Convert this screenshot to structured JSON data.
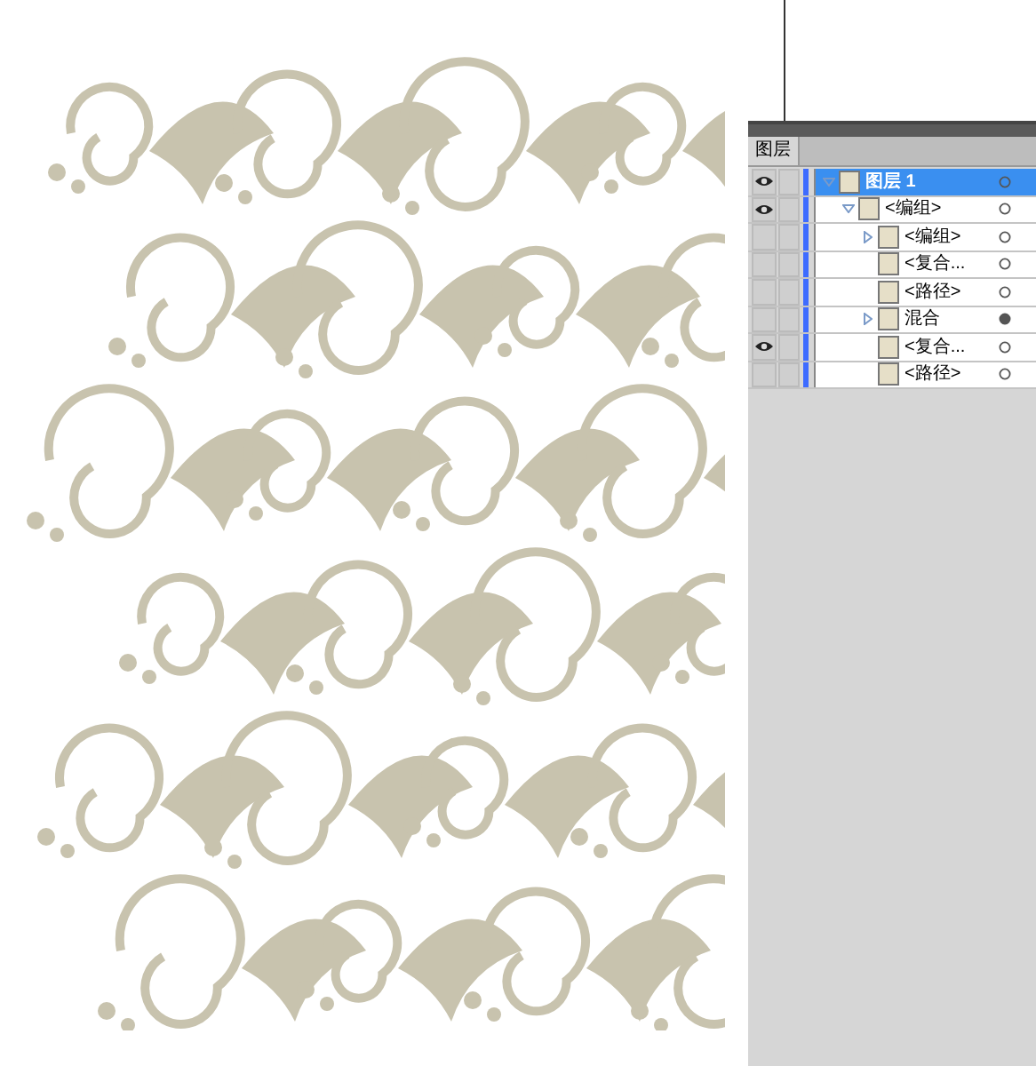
{
  "layers_panel": {
    "title": "图层",
    "layers": [
      {
        "name": "图层 1",
        "visible": true,
        "selected": true,
        "expanded": true,
        "targeted": false,
        "children": [
          {
            "name": "<编组>",
            "visible": true,
            "selected": false,
            "expanded": true,
            "targeted": false,
            "children": [
              {
                "name": "<编组>",
                "visible": false,
                "selected": false,
                "expanded": false,
                "targeted": false
              },
              {
                "name": "<复合...",
                "visible": false,
                "selected": false,
                "targeted": false
              },
              {
                "name": "<路径>",
                "visible": false,
                "selected": false,
                "targeted": false
              },
              {
                "name": "混合",
                "visible": false,
                "selected": false,
                "expanded": false,
                "targeted": true
              },
              {
                "name": "<复合...",
                "visible": true,
                "selected": false,
                "targeted": false
              },
              {
                "name": "<路径>",
                "visible": false,
                "selected": false,
                "targeted": false
              }
            ]
          }
        ]
      }
    ]
  }
}
